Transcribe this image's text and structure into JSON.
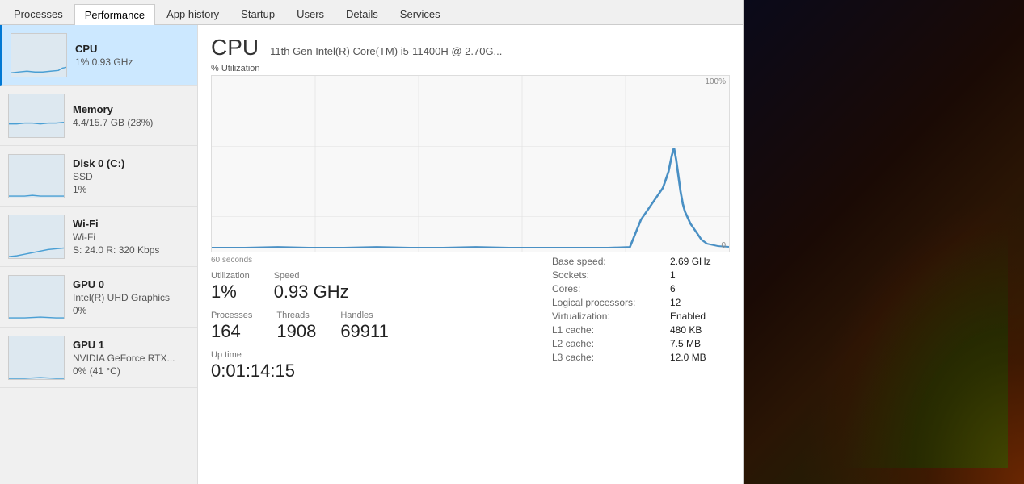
{
  "tabs": [
    {
      "label": "Processes",
      "active": false
    },
    {
      "label": "Performance",
      "active": true
    },
    {
      "label": "App history",
      "active": false
    },
    {
      "label": "Startup",
      "active": false
    },
    {
      "label": "Users",
      "active": false
    },
    {
      "label": "Details",
      "active": false
    },
    {
      "label": "Services",
      "active": false
    }
  ],
  "sidebar": {
    "items": [
      {
        "id": "cpu",
        "title": "CPU",
        "subtitle1": "1% 0.93 GHz",
        "subtitle2": "",
        "active": true
      },
      {
        "id": "memory",
        "title": "Memory",
        "subtitle1": "4.4/15.7 GB (28%)",
        "subtitle2": "",
        "active": false
      },
      {
        "id": "disk",
        "title": "Disk 0 (C:)",
        "subtitle1": "SSD",
        "subtitle2": "1%",
        "active": false
      },
      {
        "id": "wifi",
        "title": "Wi-Fi",
        "subtitle1": "Wi-Fi",
        "subtitle2": "S: 24.0  R: 320 Kbps",
        "active": false
      },
      {
        "id": "gpu0",
        "title": "GPU 0",
        "subtitle1": "Intel(R) UHD Graphics",
        "subtitle2": "0%",
        "active": false
      },
      {
        "id": "gpu1",
        "title": "GPU 1",
        "subtitle1": "NVIDIA GeForce RTX...",
        "subtitle2": "0% (41 °C)",
        "active": false
      }
    ]
  },
  "detail": {
    "cpu_label": "CPU",
    "cpu_name": "11th Gen Intel(R) Core(TM) i5-11400H @ 2.70G...",
    "util_label": "% Utilization",
    "chart_max": "100%",
    "chart_time": "60 seconds",
    "chart_min": "0",
    "utilization_label": "Utilization",
    "utilization_value": "1%",
    "speed_label": "Speed",
    "speed_value": "0.93 GHz",
    "processes_label": "Processes",
    "processes_value": "164",
    "threads_label": "Threads",
    "threads_value": "1908",
    "handles_label": "Handles",
    "handles_value": "69911",
    "uptime_label": "Up time",
    "uptime_value": "0:01:14:15",
    "base_speed_label": "Base speed:",
    "base_speed_value": "2.69 GHz",
    "sockets_label": "Sockets:",
    "sockets_value": "1",
    "cores_label": "Cores:",
    "cores_value": "6",
    "logical_label": "Logical processors:",
    "logical_value": "12",
    "virt_label": "Virtualization:",
    "virt_value": "Enabled",
    "l1_label": "L1 cache:",
    "l1_value": "480 KB",
    "l2_label": "L2 cache:",
    "l2_value": "7.5 MB",
    "l3_label": "L3 cache:",
    "l3_value": "12.0 MB"
  }
}
